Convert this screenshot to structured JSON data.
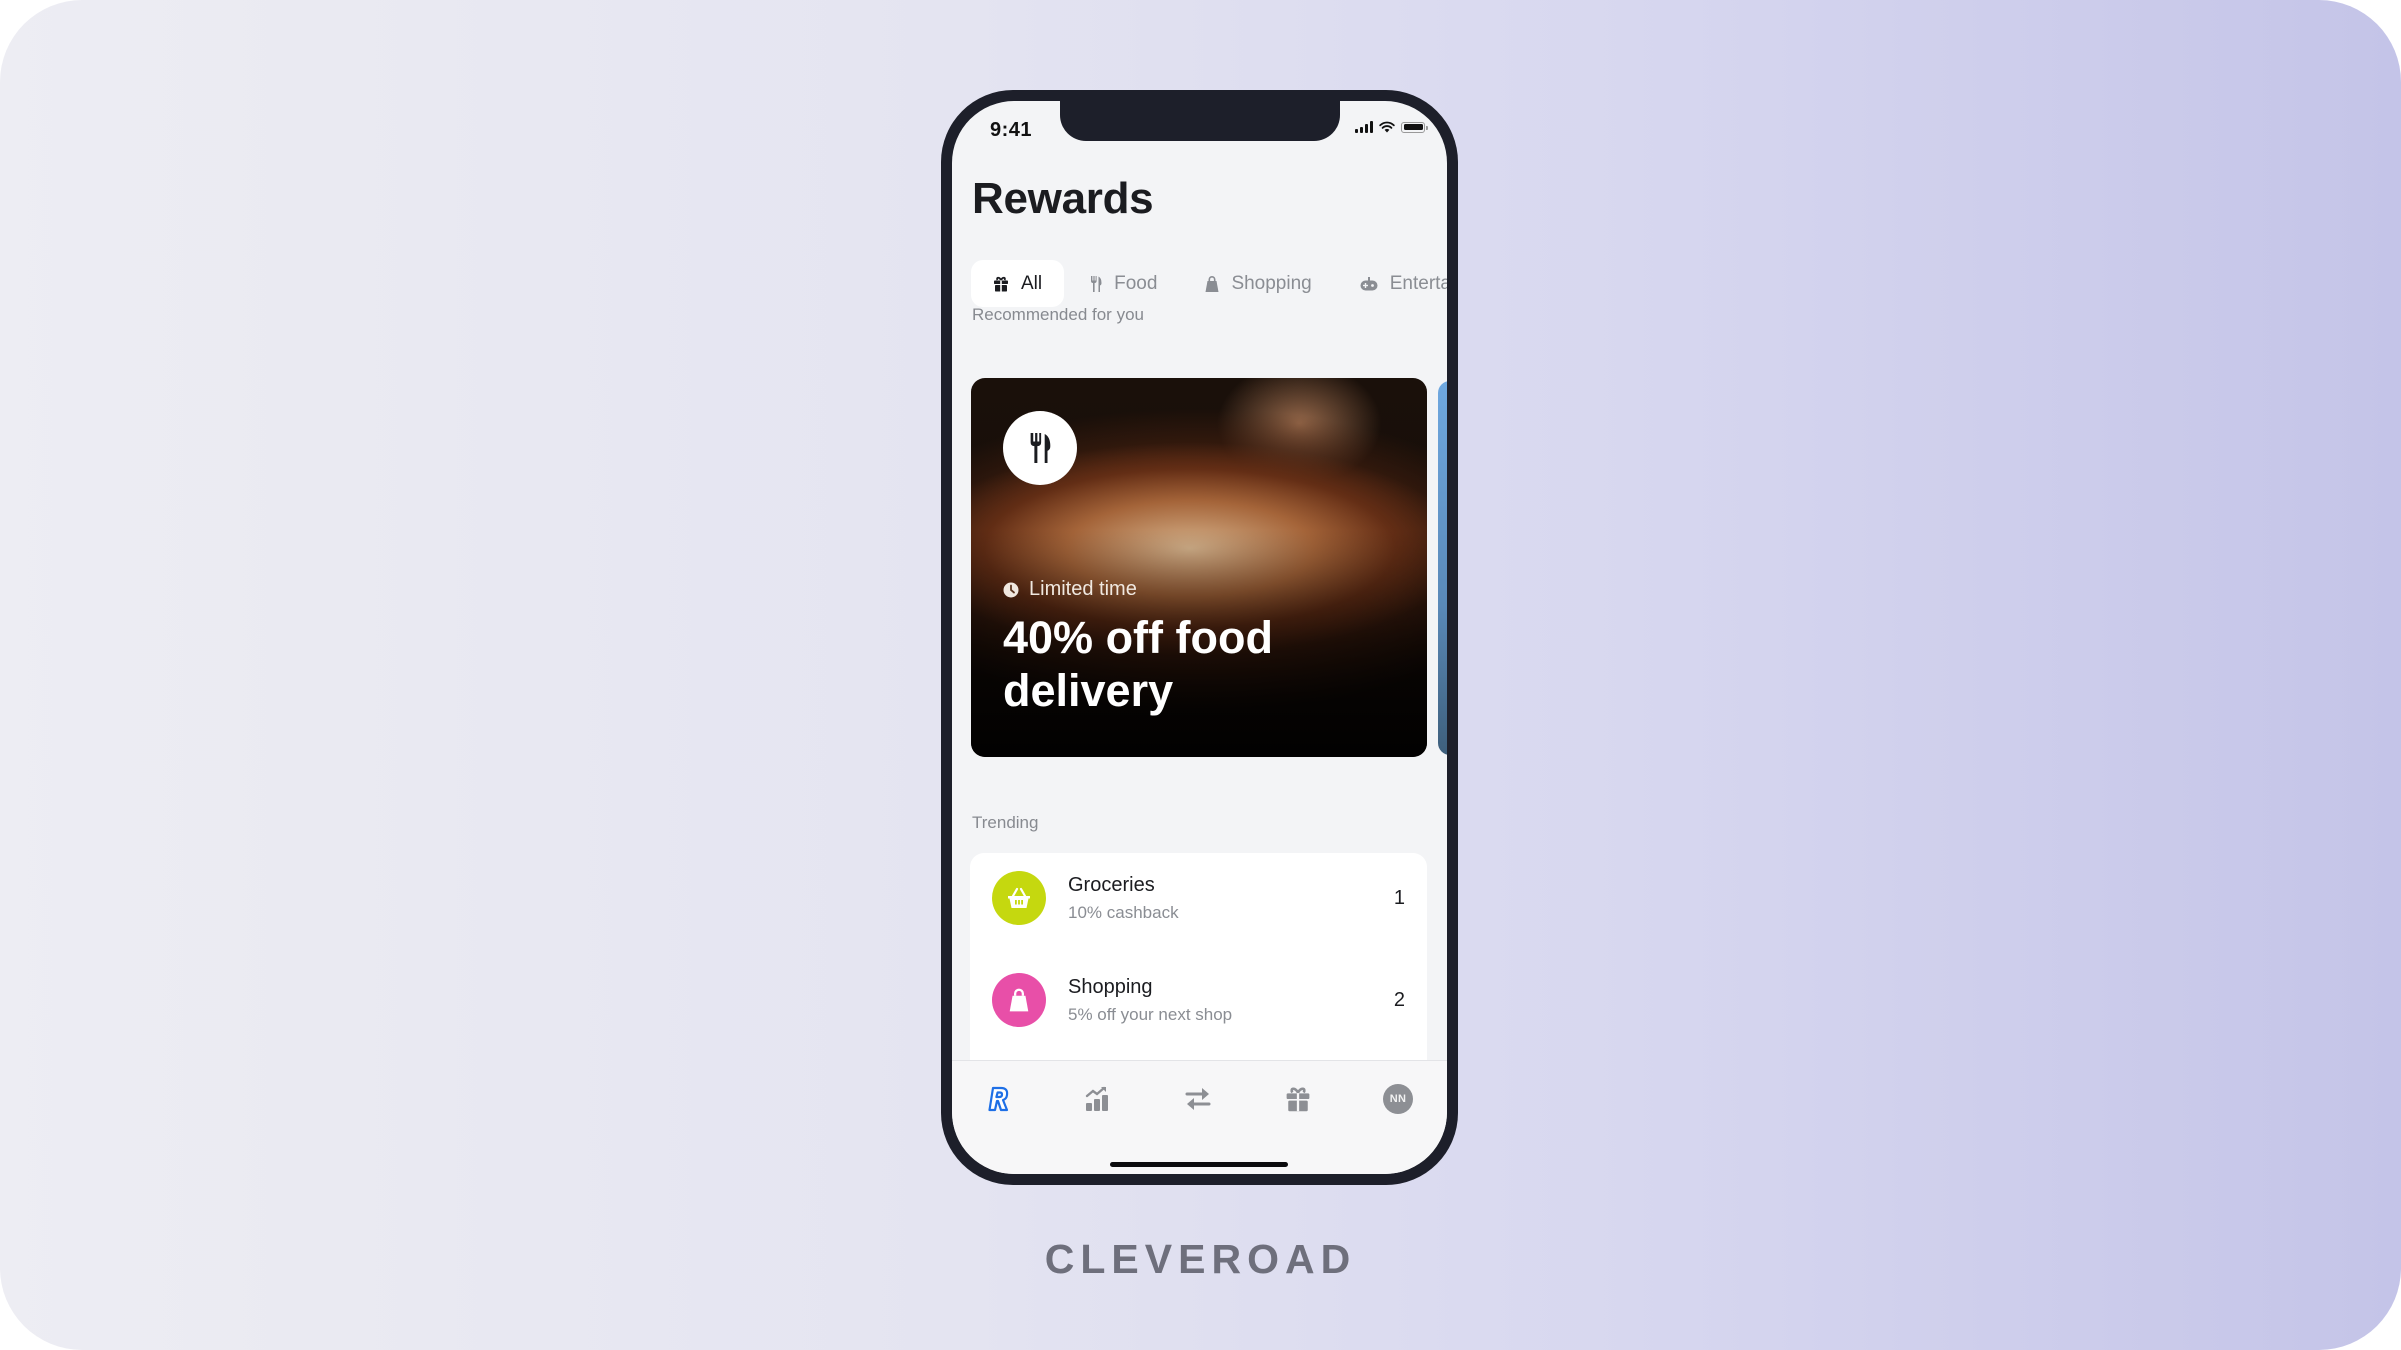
{
  "status_bar": {
    "time": "9:41",
    "icons": [
      "cellular-signal-icon",
      "wifi-icon",
      "battery-icon"
    ]
  },
  "page": {
    "title": "Rewards"
  },
  "tabs": [
    {
      "label": "All",
      "icon": "gift-icon",
      "active": true
    },
    {
      "label": "Food",
      "icon": "cutlery-icon",
      "active": false
    },
    {
      "label": "Shopping",
      "icon": "shopping-bag-icon",
      "active": false
    },
    {
      "label": "Entertainment",
      "icon": "gamepad-icon",
      "active": false
    }
  ],
  "recommended": {
    "label": "Recommended for you",
    "card": {
      "icon": "cutlery-icon",
      "tag": "Limited time",
      "tag_icon": "clock-icon",
      "title": "40% off food delivery"
    }
  },
  "trending": {
    "label": "Trending",
    "items": [
      {
        "title": "Groceries",
        "subtitle": "10% cashback",
        "rank": "1",
        "icon": "basket-icon",
        "color": "#c5d80f"
      },
      {
        "title": "Shopping",
        "subtitle": "5% off your next shop",
        "rank": "2",
        "icon": "shopping-bag-icon",
        "color": "#e84fa8"
      }
    ]
  },
  "bottom_nav": {
    "items": [
      {
        "name": "home",
        "icon": "revolut-logo-icon",
        "active": true
      },
      {
        "name": "analytics",
        "icon": "chart-icon",
        "active": false
      },
      {
        "name": "transfers",
        "icon": "transfer-arrows-icon",
        "active": false
      },
      {
        "name": "rewards",
        "icon": "gift-icon",
        "active": false
      },
      {
        "name": "profile",
        "icon": "avatar",
        "initials": "NN",
        "active": false
      }
    ],
    "active_color": "#1e6fe6",
    "inactive_color": "#8d8f94"
  },
  "brand": {
    "name": "CLEVEROAD"
  }
}
